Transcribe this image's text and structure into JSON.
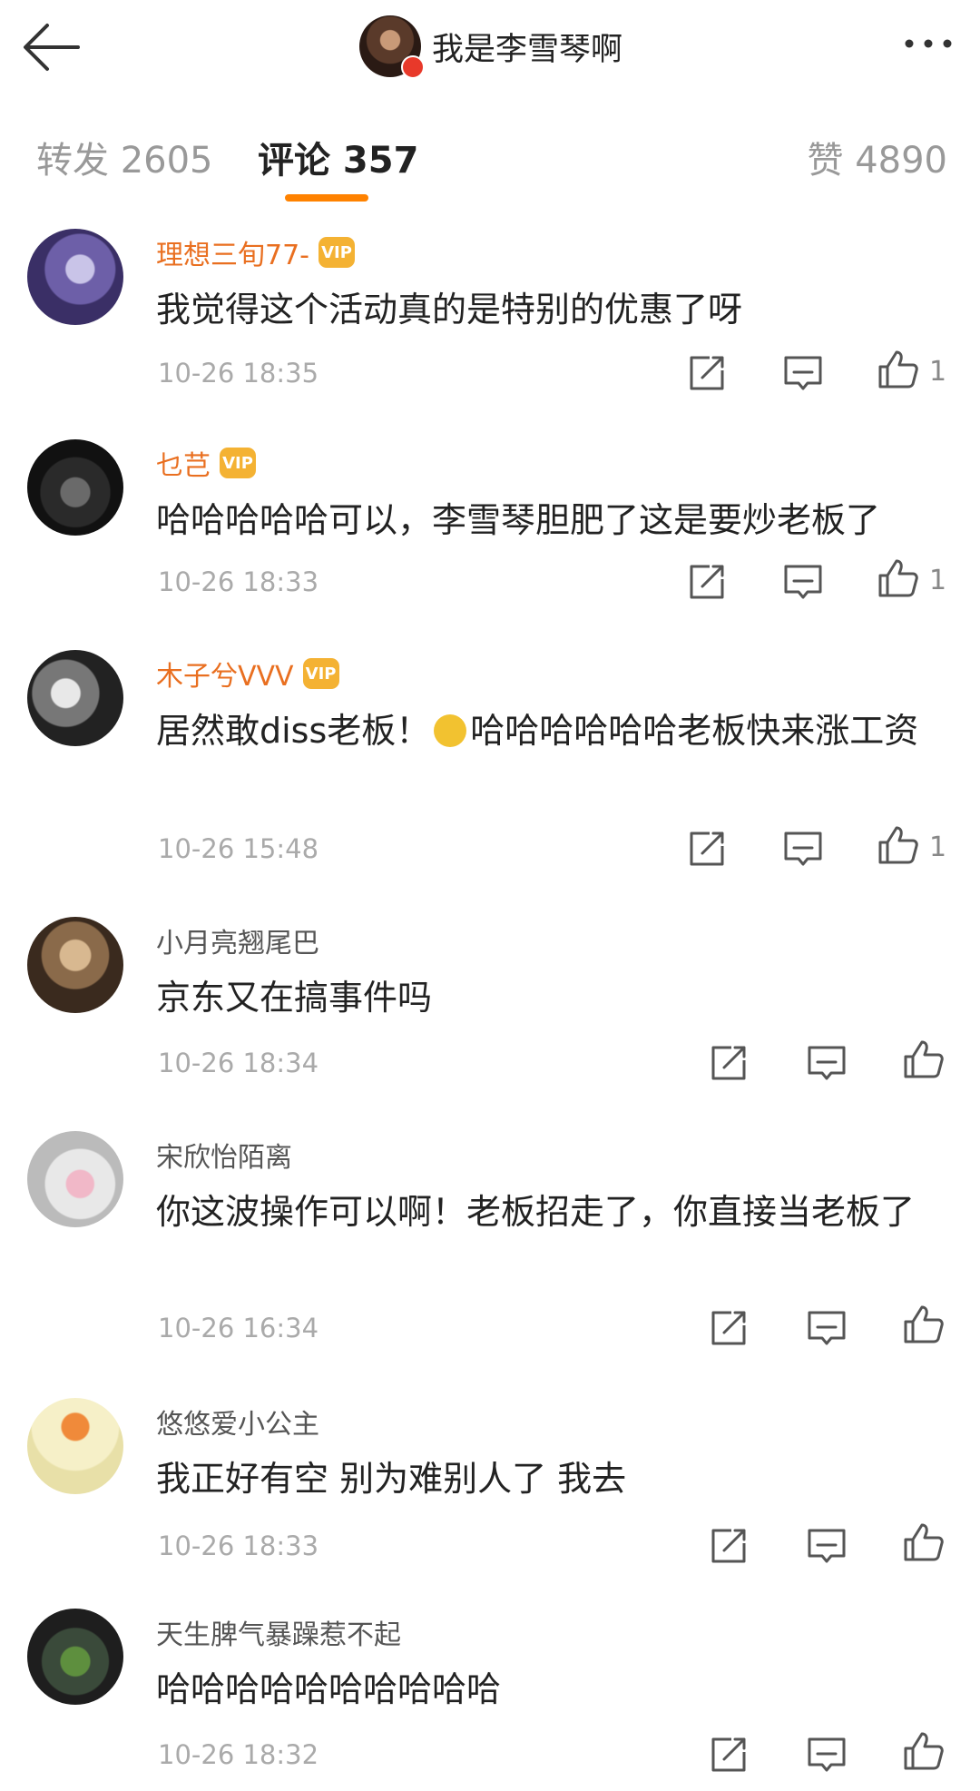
{
  "header": {
    "title": "我是李雪琴啊"
  },
  "tabs": {
    "repost": "转发 2605",
    "comments": "评论 357",
    "likes": "赞 4890"
  },
  "colors": {
    "accent": "#ff8200",
    "vip_name": "#e96f20",
    "badge": "#f4b233"
  },
  "icons": {
    "back": "back-arrow-icon",
    "more": "more-dots-icon",
    "repost": "repost-icon",
    "comment": "comment-icon",
    "like": "thumbs-up-icon"
  },
  "comments": [
    {
      "user": "理想三旬77-",
      "text": "我觉得这个活动真的是特别的优惠了呀",
      "time": "10-26 18:35",
      "likes": "1"
    },
    {
      "user": "乜芑",
      "text": "哈哈哈哈哈可以，李雪琴胆肥了这是要炒老板了",
      "time": "10-26 18:33",
      "likes": "1"
    },
    {
      "user": "木子兮VVV",
      "text_before": "居然敢diss老板！",
      "text_after": "哈哈哈哈哈哈老板快来涨工资",
      "time": "10-26 15:48",
      "likes": "1"
    },
    {
      "user": "小月亮翘尾巴",
      "text": "京东又在搞事件吗",
      "time": "10-26 18:34",
      "likes": ""
    },
    {
      "user": "宋欣怡陌离",
      "text": "你这波操作可以啊！老板招走了，你直接当老板了",
      "time": "10-26 16:34",
      "likes": ""
    },
    {
      "user": "悠悠爱小公主",
      "text": "我正好有空 别为难别人了 我去",
      "time": "10-26 18:33",
      "likes": ""
    },
    {
      "user": "天生脾气暴躁惹不起",
      "text": "哈哈哈哈哈哈哈哈哈哈",
      "time": "10-26 18:32",
      "likes": ""
    }
  ]
}
